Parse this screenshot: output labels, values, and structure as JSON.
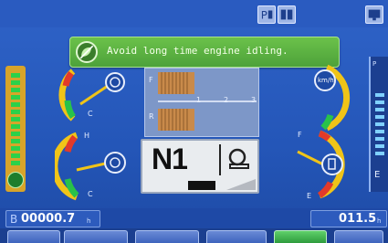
{
  "message": {
    "text": "Avoid long time engine idling."
  },
  "gear": {
    "label": "N1"
  },
  "axis": {
    "r_label": "F",
    "r_label2": "R",
    "s1": "1",
    "s2": "2",
    "s3": "3"
  },
  "gauges": {
    "speed_unit": "km/h",
    "coolant_label": "H",
    "coolant_c": "C",
    "fuel_f": "F",
    "fuel_e": "E",
    "left_c": "C"
  },
  "odometer": {
    "prefix": "B",
    "value": "00000.7",
    "unit": "h"
  },
  "trip": {
    "value": "011.5",
    "unit": "h"
  },
  "right_side": {
    "label": "P",
    "bottom": "E"
  },
  "buttons": [
    "",
    "",
    "",
    "",
    "",
    "",
    ""
  ],
  "icons": {
    "top": [
      "parking-icon",
      "display-icon",
      "screen-icon"
    ],
    "message": "leaf-no-idle-icon",
    "gear": "engine-icon"
  },
  "colors": {
    "background": "#2456b8",
    "message": "#4da23a",
    "gauge_yellow": "#f0c418",
    "gauge_red": "#e23a2a",
    "gauge_green": "#28c24a"
  }
}
